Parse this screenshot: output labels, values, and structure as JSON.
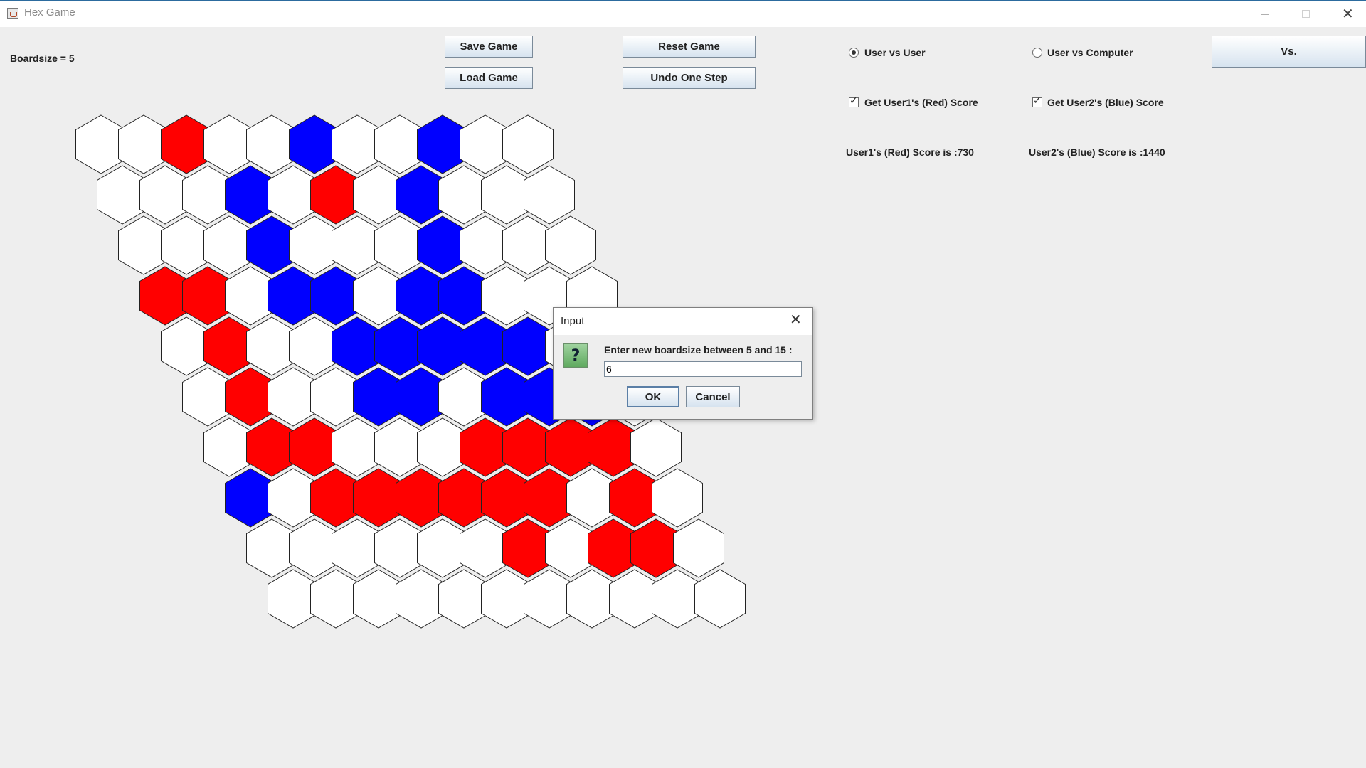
{
  "window": {
    "title": "Hex Game"
  },
  "boardsize_label": "Boardsize = 5",
  "buttons": {
    "save": "Save Game",
    "load": "Load Game",
    "reset": "Reset Game",
    "undo": "Undo One Step",
    "vs": "Vs."
  },
  "mode": {
    "options": [
      {
        "label": "User vs User",
        "selected": true
      },
      {
        "label": "User vs Computer",
        "selected": false
      }
    ]
  },
  "score_toggles": [
    {
      "label": "Get User1's (Red) Score",
      "checked": true
    },
    {
      "label": "Get User2's (Blue) Score",
      "checked": true
    }
  ],
  "scores": {
    "red": "User1's (Red) Score is :730",
    "blue": "User2's (Blue) Score is :1440"
  },
  "colors": {
    "red": "#ff0000",
    "blue": "#0000ff",
    "empty": "#ffffff",
    "outline": "#222222"
  },
  "board": {
    "size_label_value": 5,
    "rows": [
      "..R..B..B..",
      "...B.R.B...",
      "...B...B...",
      "RR.BB.BB...",
      ".R..BBBBB.B",
      ".R..BB.BBB.",
      ".RR...RRRR.",
      "B.RRRRRR.R.",
      "......R.RR.",
      "..........."
    ]
  },
  "dialog": {
    "title": "Input",
    "prompt": "Enter new boardsize between 5 and 15 :",
    "value": "6",
    "ok": "OK",
    "cancel": "Cancel",
    "icon": "question-icon"
  }
}
